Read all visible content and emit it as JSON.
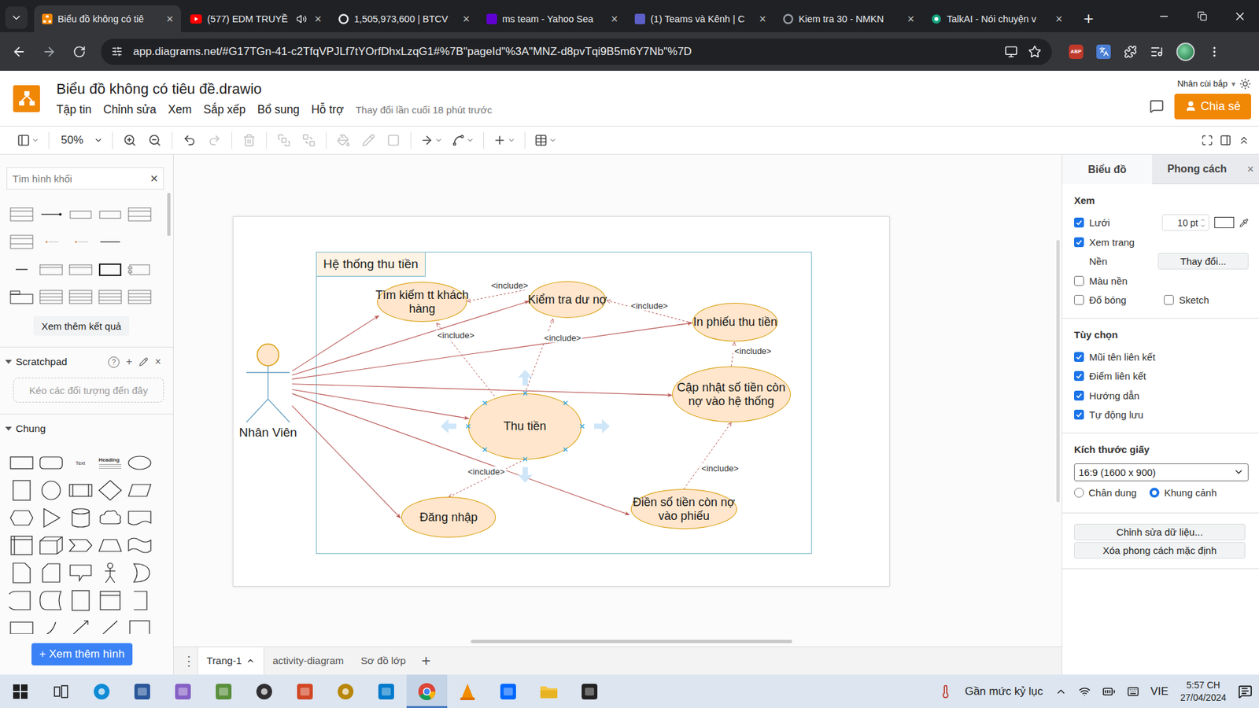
{
  "browser": {
    "tabs": [
      {
        "label": "Biểu đồ không có tiê",
        "selected": true,
        "audio": false
      },
      {
        "label": "(577) EDM TRUYỀ",
        "selected": false,
        "audio": true
      },
      {
        "label": "1,505,973,600 | BTCV",
        "selected": false,
        "audio": false
      },
      {
        "label": "ms team - Yahoo Sea",
        "selected": false,
        "audio": false
      },
      {
        "label": "(1) Teams và Kênh | C",
        "selected": false,
        "audio": false
      },
      {
        "label": "Kiem tra 30 - NMKN",
        "selected": false,
        "audio": false
      },
      {
        "label": "TalkAI - Nói chuyện v",
        "selected": false,
        "audio": false
      }
    ],
    "tab_close": "×",
    "new_tab": "+",
    "url": "app.diagrams.net/#G17TGn-41-c2TfqVPJLf7tYOrfDhxLzqG1#%7B\"pageId\"%3A\"MNZ-d8pvTqi9B5m6Y7Nb\"%7D",
    "extension_badge": "ABP"
  },
  "app": {
    "title": "Biểu đồ không có tiêu đề.drawio",
    "menus": [
      "Tập tin",
      "Chỉnh sửa",
      "Xem",
      "Sắp xếp",
      "Bổ sung",
      "Hỗ trợ"
    ],
    "last_saved": "Thay đổi lần cuối 18 phút trước",
    "user": "Nhân cùi bắp",
    "user_caret": "▾",
    "share": "Chia sẻ"
  },
  "toolbar": {
    "zoom": "50%",
    "tools": [
      {
        "disabled": false
      },
      {
        "disabled": false
      },
      {
        "disabled": false
      },
      {
        "disabled": true
      },
      {
        "disabled": true
      },
      {
        "disabled": true
      },
      {
        "disabled": true
      },
      {
        "disabled": true
      },
      {
        "disabled": true
      },
      {
        "disabled": true
      },
      {
        "disabled": false
      },
      {
        "disabled": false
      },
      {
        "disabled": false
      },
      {
        "disabled": false
      }
    ]
  },
  "sidebar": {
    "search_placeholder": "Tìm hình khối",
    "search_clear": "×",
    "more_results": "Xem thêm kết quả",
    "scratchpad": {
      "title": "Scratchpad",
      "expanded": true,
      "help": "?",
      "add": "+",
      "close": "×",
      "hint": "Kéo các đối tượng đến đây"
    },
    "section": {
      "title": "Chung",
      "expanded": true
    },
    "shape_text": "Text",
    "shape_heading": "Heading",
    "more_shapes": "+ Xem thêm hình"
  },
  "diagram": {
    "container": "Hệ thống thu tiền",
    "actor": "Nhân Viên",
    "usecases": [
      {
        "label": "Tìm kiếm tt khách hàng",
        "hover": false
      },
      {
        "label": "Kiểm tra dư nợ",
        "hover": false
      },
      {
        "label": "In phiếu thu tiền",
        "hover": false
      },
      {
        "label": "Cập nhật số tiền còn nợ vào hệ thống",
        "hover": false
      },
      {
        "label": "Thu tiền",
        "hover": true
      },
      {
        "label": "Đăng nhập",
        "hover": false
      },
      {
        "label": "Điền số tiền còn nợ vào phiếu",
        "hover": false
      }
    ],
    "edges": [
      {
        "kind": "association"
      },
      {
        "kind": "association"
      },
      {
        "kind": "association"
      },
      {
        "kind": "association"
      },
      {
        "kind": "association"
      },
      {
        "kind": "association"
      },
      {
        "kind": "association"
      },
      {
        "kind": "include",
        "label": "<include>"
      },
      {
        "kind": "include",
        "label": "<include>"
      },
      {
        "kind": "include",
        "label": "<include>"
      },
      {
        "kind": "include",
        "label": "<include>"
      },
      {
        "kind": "include",
        "label": "<include>"
      },
      {
        "kind": "include",
        "label": "<include>"
      },
      {
        "kind": "include",
        "label": "<include>"
      }
    ]
  },
  "pages": {
    "menu": "⋮",
    "items": [
      {
        "label": "Trang-1",
        "selected": true
      },
      {
        "label": "activity-diagram",
        "selected": false
      },
      {
        "label": "Sơ đồ lớp",
        "selected": false
      }
    ],
    "add": "+"
  },
  "format": {
    "tabs": [
      {
        "label": "Biểu đồ",
        "selected": true
      },
      {
        "label": "Phong cách",
        "selected": false
      }
    ],
    "close": "×",
    "view": {
      "title": "Xem",
      "grid": {
        "label": "Lưới",
        "checked": true,
        "size": "10 pt"
      },
      "page_view": {
        "label": "Xem trang",
        "checked": true
      },
      "background": {
        "label": "Nền",
        "button": "Thay đổi..."
      },
      "background_color": {
        "label": "Màu nền",
        "checked": false
      },
      "shadow": {
        "label": "Đổ bóng",
        "checked": false
      },
      "sketch": {
        "label": "Sketch",
        "checked": false
      }
    },
    "options": {
      "title": "Tùy chọn",
      "items": [
        {
          "label": "Mũi tên liên kết",
          "checked": true
        },
        {
          "label": "Điểm liên kết",
          "checked": true
        },
        {
          "label": "Hướng dẫn",
          "checked": true
        },
        {
          "label": "Tự động lưu",
          "checked": true
        }
      ]
    },
    "paper": {
      "title": "Kích thước giấy",
      "size": "16:9 (1600 x 900)",
      "orientations": [
        {
          "label": "Chân dung",
          "selected": false
        },
        {
          "label": "Khung cảnh",
          "selected": true
        }
      ]
    },
    "actions": [
      "Chỉnh sửa dữ liệu...",
      "Xóa phong cách mặc định"
    ]
  },
  "taskbar": {
    "apps": [
      {
        "selected": false
      },
      {
        "selected": false
      },
      {
        "selected": false
      },
      {
        "selected": false
      },
      {
        "selected": false
      },
      {
        "selected": false
      },
      {
        "selected": false
      },
      {
        "selected": false
      },
      {
        "selected": false
      },
      {
        "selected": false
      },
      {
        "selected": true
      },
      {
        "selected": false
      },
      {
        "selected": false
      },
      {
        "selected": false
      },
      {
        "selected": false
      }
    ],
    "weather": "Gần mức kỷ lục",
    "language": "VIE",
    "time": "5:57 CH",
    "date": "27/04/2024"
  }
}
